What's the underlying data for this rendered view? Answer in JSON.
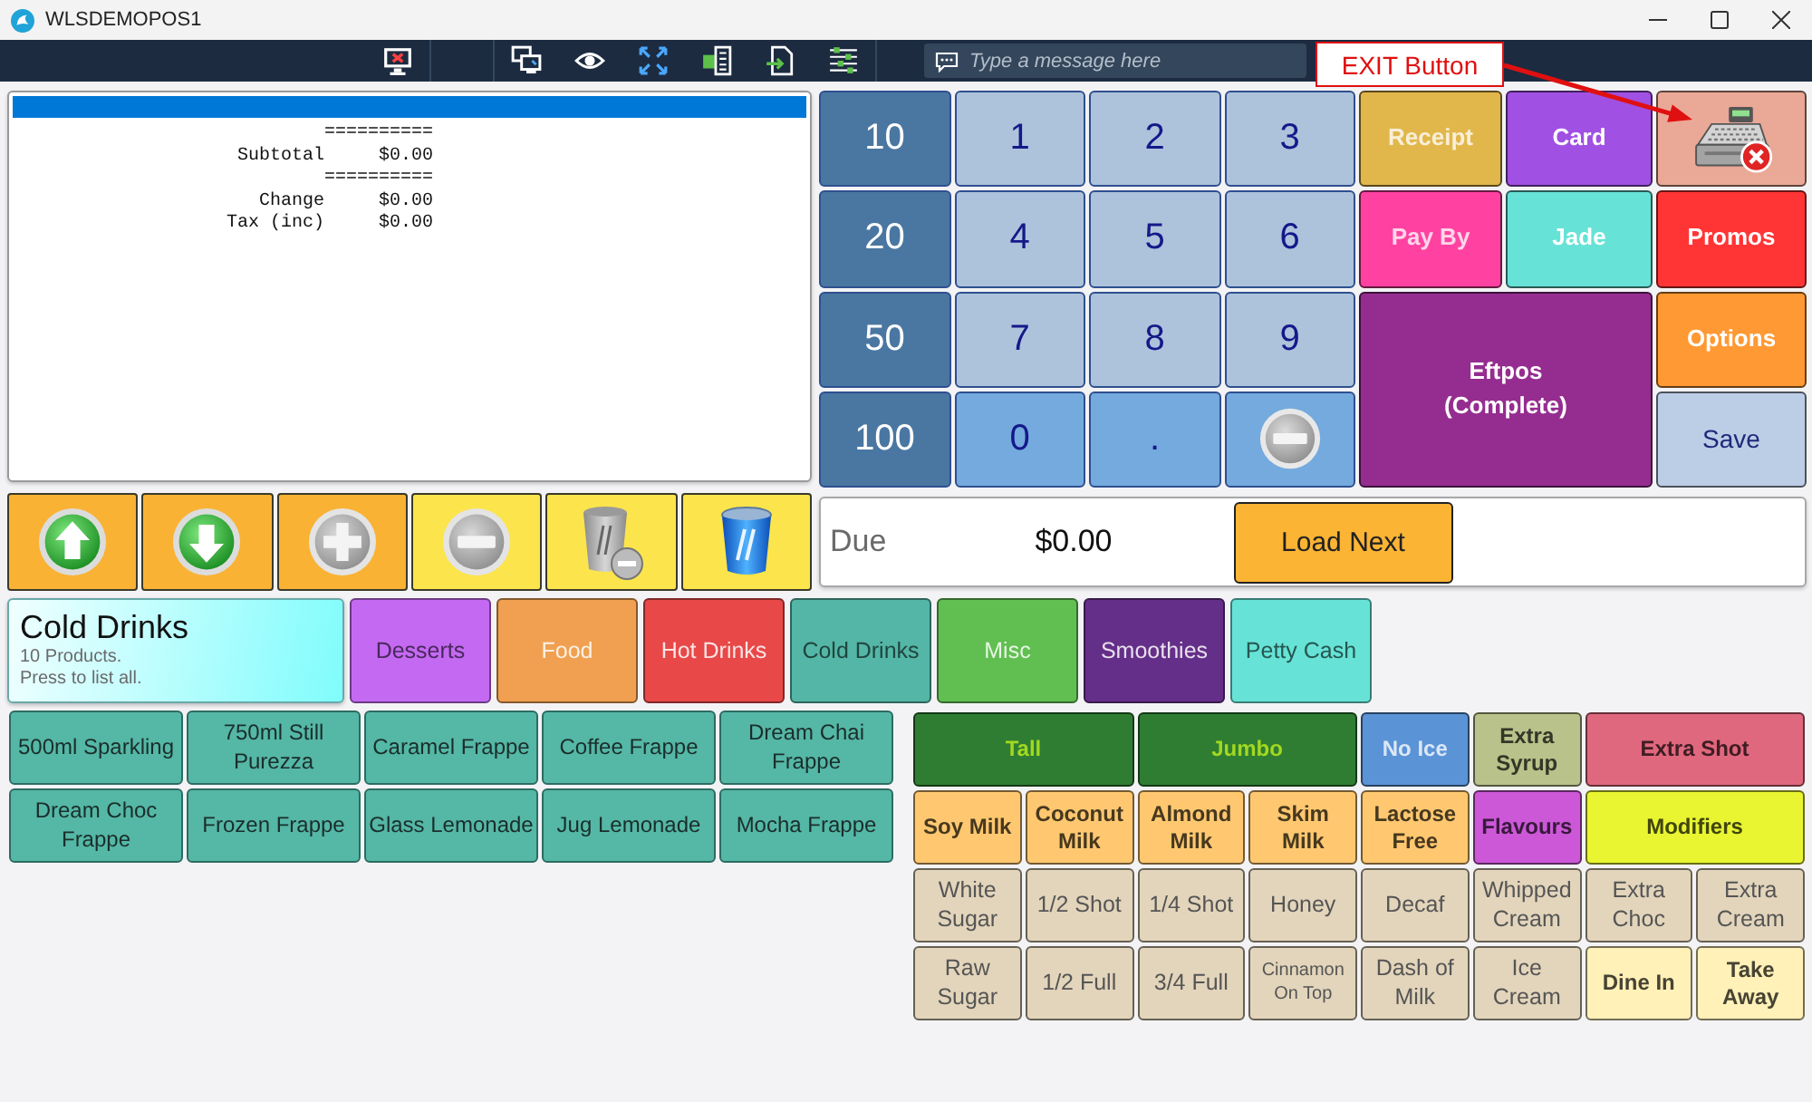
{
  "window": {
    "title": "WLSDEMOPOS1"
  },
  "toolbar": {
    "message_field": {
      "placeholder": "Type a message here"
    }
  },
  "annotation": {
    "text": "EXIT Button"
  },
  "receipt": {
    "lines": [
      {
        "kind": "rule",
        "text": "=========="
      },
      {
        "kind": "amount",
        "label": "Subtotal",
        "value": "$0.00"
      },
      {
        "kind": "rule",
        "text": "=========="
      },
      {
        "kind": "amount",
        "label": "Change",
        "value": "$0.00"
      },
      {
        "kind": "amount",
        "label": "Tax (inc)",
        "value": "$0.00"
      }
    ]
  },
  "order_actions": [
    {
      "kind": "up",
      "color": "#f9b233"
    },
    {
      "kind": "down",
      "color": "#f9b233"
    },
    {
      "kind": "add",
      "color": "#f9b233"
    },
    {
      "kind": "remove",
      "color": "#fce44c"
    },
    {
      "kind": "delete",
      "color": "#fce44c"
    },
    {
      "kind": "clear",
      "color": "#fce44c"
    }
  ],
  "keypad": [
    {
      "kind": "note",
      "label": "10"
    },
    {
      "kind": "digit",
      "label": "1"
    },
    {
      "kind": "digit",
      "label": "2"
    },
    {
      "kind": "digit",
      "label": "3"
    },
    {
      "kind": "note",
      "label": "20"
    },
    {
      "kind": "digit",
      "label": "4"
    },
    {
      "kind": "digit",
      "label": "5"
    },
    {
      "kind": "digit",
      "label": "6"
    },
    {
      "kind": "note",
      "label": "50"
    },
    {
      "kind": "digit",
      "label": "7"
    },
    {
      "kind": "digit",
      "label": "8"
    },
    {
      "kind": "digit",
      "label": "9"
    },
    {
      "kind": "note",
      "label": "100"
    },
    {
      "kind": "bright",
      "label": "0"
    },
    {
      "kind": "bright",
      "label": "."
    },
    {
      "kind": "backspace"
    }
  ],
  "tenders": [
    {
      "kind": "tinted",
      "label": "Receipt",
      "color": "#e1b74b"
    },
    {
      "kind": "solid",
      "label": "Card",
      "color": "#a050e2"
    },
    {
      "kind": "exit",
      "color": "#eaa896"
    },
    {
      "kind": "tinted",
      "label": "Pay By",
      "color": "#ff42a1"
    },
    {
      "kind": "solid",
      "label": "Jade",
      "color": "#66e2d6"
    },
    {
      "kind": "solid",
      "label": "Promos",
      "color": "#ff3535"
    },
    {
      "kind": "large",
      "label": "Eftpos\n(Complete)",
      "color": "#952d90"
    },
    {
      "kind": "solid",
      "label": "Options",
      "color": "#ff9933"
    },
    {
      "kind": "plain",
      "label": "Save",
      "color": "#bccde6"
    }
  ],
  "due": {
    "label": "Due",
    "amount": "$0.00",
    "button": "Load Next"
  },
  "category_summary": {
    "title": "Cold Drinks",
    "count": "10 Products.",
    "hint": "Press to list all."
  },
  "categories": [
    {
      "label": "Desserts",
      "kind": "dark",
      "color": "#c46af2"
    },
    {
      "label": "Food",
      "kind": "light",
      "color": "#f0a050"
    },
    {
      "label": "Hot Drinks",
      "kind": "light",
      "color": "#e84848"
    },
    {
      "label": "Cold Drinks",
      "kind": "dark",
      "color": "#54b6a6"
    },
    {
      "label": "Misc",
      "kind": "light",
      "color": "#60bf50"
    },
    {
      "label": "Smoothies",
      "kind": "light",
      "color": "#642f88"
    },
    {
      "label": "Petty Cash",
      "kind": "dark",
      "color": "#66e3d6"
    }
  ],
  "products": [
    "500ml Sparkling",
    "750ml Still Purezza",
    "Caramel Frappe",
    "Coffee Frappe",
    "Dream Chai Frappe",
    "Dream Choc Frappe",
    "Frozen Frappe",
    "Glass Lemonade",
    "Jug Lemonade",
    "Mocha Frappe"
  ],
  "modifiers": [
    {
      "label": "Tall",
      "kind": "size",
      "color": "#2e7d32",
      "wide": true
    },
    {
      "label": "Jumbo",
      "kind": "size",
      "color": "#2e7d32",
      "wide": true
    },
    {
      "label": "No Ice",
      "kind": "light",
      "color": "#5a93d6",
      "wide": false
    },
    {
      "label": "Extra Syrup",
      "kind": "dark",
      "color": "#b9c28a",
      "wide": false
    },
    {
      "label": "Extra Shot",
      "kind": "dark",
      "color": "#e0687e",
      "wide": true
    },
    {
      "label": "Soy Milk",
      "kind": "dark",
      "color": "#ffc870",
      "wide": false
    },
    {
      "label": "Coconut Milk",
      "kind": "dark",
      "color": "#ffc870",
      "wide": false
    },
    {
      "label": "Almond Milk",
      "kind": "dark",
      "color": "#ffc870",
      "wide": false
    },
    {
      "label": "Skim Milk",
      "kind": "dark",
      "color": "#ffc870",
      "wide": false
    },
    {
      "label": "Lactose Free",
      "kind": "dark",
      "color": "#ffc870",
      "wide": false
    },
    {
      "label": "Flavours",
      "kind": "dark",
      "color": "#cc58d8",
      "wide": false
    },
    {
      "label": "Modifiers",
      "kind": "dark",
      "color": "#e8f530",
      "wide": true
    },
    {
      "label": "White Sugar",
      "kind": "plain",
      "color": "#e3d5bb",
      "wide": false
    },
    {
      "label": "1/2 Shot",
      "kind": "plain",
      "color": "#e3d5bb",
      "wide": false
    },
    {
      "label": "1/4 Shot",
      "kind": "plain",
      "color": "#e3d5bb",
      "wide": false
    },
    {
      "label": "Honey",
      "kind": "plain",
      "color": "#e3d5bb",
      "wide": false
    },
    {
      "label": "Decaf",
      "kind": "plain",
      "color": "#e3d5bb",
      "wide": false
    },
    {
      "label": "Whipped Cream",
      "kind": "plain",
      "color": "#e3d5bb",
      "wide": false
    },
    {
      "label": "Extra Choc",
      "kind": "plain",
      "color": "#e3d5bb",
      "wide": false
    },
    {
      "label": "Extra Cream",
      "kind": "plain",
      "color": "#e3d5bb",
      "wide": false
    },
    {
      "label": "Raw Sugar",
      "kind": "plain",
      "color": "#e3d5bb",
      "wide": false
    },
    {
      "label": "1/2 Full",
      "kind": "plain",
      "color": "#e3d5bb",
      "wide": false
    },
    {
      "label": "3/4 Full",
      "kind": "plain",
      "color": "#e3d5bb",
      "wide": false
    },
    {
      "label": "Cinnamon On Top",
      "kind": "plain",
      "color": "#e3d5bb",
      "wide": false
    },
    {
      "label": "Dash of Milk",
      "kind": "plain",
      "color": "#e3d5bb",
      "wide": false
    },
    {
      "label": "Ice Cream",
      "kind": "plain",
      "color": "#e3d5bb",
      "wide": false
    },
    {
      "label": "Dine In",
      "kind": "dark",
      "color": "#fff1b8",
      "wide": false
    },
    {
      "label": "Take Away",
      "kind": "dark",
      "color": "#fff1b8",
      "wide": false
    }
  ]
}
